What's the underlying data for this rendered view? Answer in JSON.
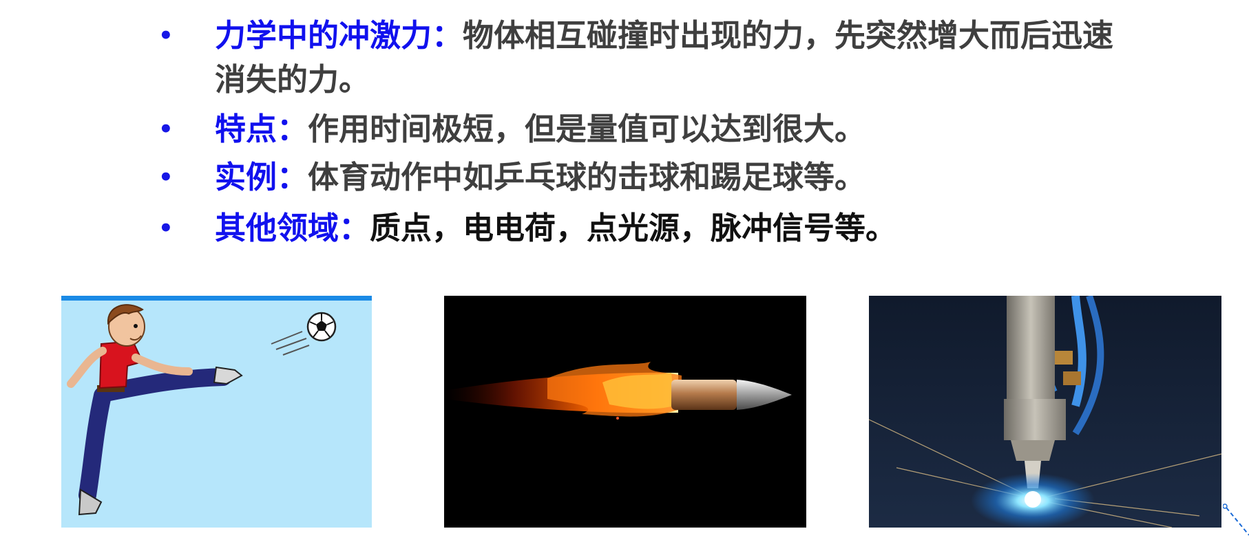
{
  "bullets": [
    {
      "term": "力学中的冲激力",
      "colon": "：",
      "desc": "物体相互碰撞时出现的力，先突然增大而后迅速消失的力。"
    },
    {
      "term": "特点",
      "colon": "：",
      "desc": "作用时间极短，但是量值可以达到很大。"
    },
    {
      "term": "实例",
      "colon": "：",
      "desc": "体育动作中如乒乓球的击球和踢足球等。"
    },
    {
      "term": "其他领域",
      "colon": "：",
      "desc": "质点，电电荷，点光源，脉冲信号等。"
    }
  ],
  "bullet_symbol": "•",
  "images": [
    {
      "subject": "boy-kicking-soccer-ball"
    },
    {
      "subject": "flaming-bullet"
    },
    {
      "subject": "laser-cutting-head-with-sparks"
    }
  ],
  "colors": {
    "term": "#1111ee",
    "body_text": "#3f3f3f",
    "sky": "#b6e6fb",
    "black": "#000000"
  }
}
